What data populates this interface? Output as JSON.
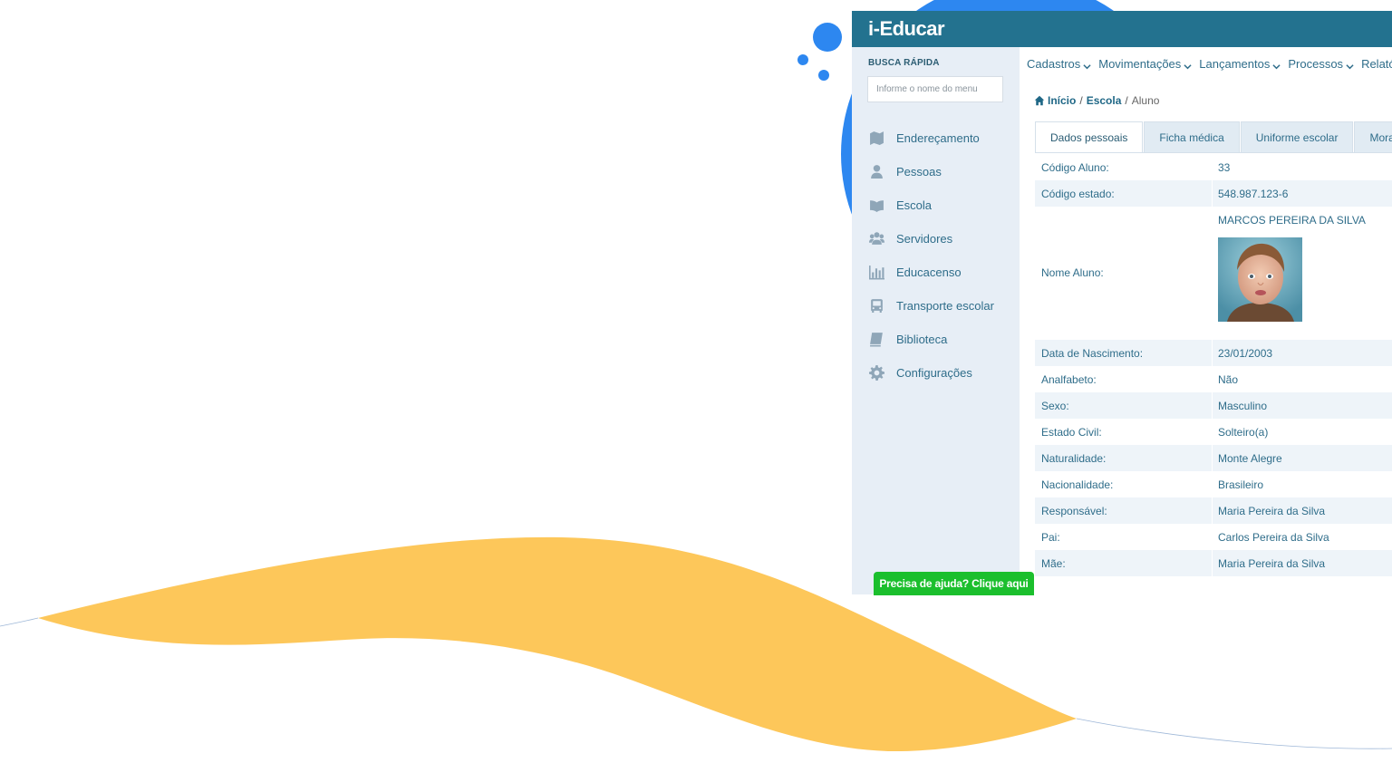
{
  "app": {
    "title": "i-Educar"
  },
  "search": {
    "label": "BUSCA RÁPIDA",
    "placeholder": "Informe o nome do menu"
  },
  "sidebar": {
    "items": [
      {
        "label": "Endereçamento",
        "icon": "map-icon"
      },
      {
        "label": "Pessoas",
        "icon": "user-icon"
      },
      {
        "label": "Escola",
        "icon": "book-open-icon"
      },
      {
        "label": "Servidores",
        "icon": "users-icon"
      },
      {
        "label": "Educacenso",
        "icon": "bar-chart-icon"
      },
      {
        "label": "Transporte escolar",
        "icon": "bus-icon"
      },
      {
        "label": "Biblioteca",
        "icon": "book-icon"
      },
      {
        "label": "Configurações",
        "icon": "gear-icon"
      }
    ]
  },
  "topmenu": {
    "items": [
      {
        "label": "Cadastros"
      },
      {
        "label": "Movimentações"
      },
      {
        "label": "Lançamentos"
      },
      {
        "label": "Processos"
      },
      {
        "label": "Relató"
      }
    ]
  },
  "breadcrumb": {
    "home": "Início",
    "section": "Escola",
    "current": "Aluno",
    "separator": "/"
  },
  "tabs": [
    {
      "label": "Dados pessoais",
      "active": true
    },
    {
      "label": "Ficha médica",
      "active": false
    },
    {
      "label": "Uniforme escolar",
      "active": false
    },
    {
      "label": "Moradia",
      "active": false
    }
  ],
  "student": {
    "rows": [
      {
        "label": "Código Aluno:",
        "value": "33"
      },
      {
        "label": "Código estado:",
        "value": "548.987.123-6"
      },
      {
        "label": "Nome Aluno:",
        "value": "MARCOS PEREIRA DA SILVA"
      },
      {
        "label": "Data de Nascimento:",
        "value": "23/01/2003"
      },
      {
        "label": "Analfabeto:",
        "value": "Não"
      },
      {
        "label": "Sexo:",
        "value": "Masculino"
      },
      {
        "label": "Estado Civil:",
        "value": "Solteiro(a)"
      },
      {
        "label": "Naturalidade:",
        "value": "Monte Alegre"
      },
      {
        "label": "Nacionalidade:",
        "value": "Brasileiro"
      },
      {
        "label": "Responsável:",
        "value": "Maria Pereira da Silva"
      },
      {
        "label": "Pai:",
        "value": "Carlos Pereira da Silva"
      },
      {
        "label": "Mãe:",
        "value": "Maria Pereira da Silva"
      }
    ]
  },
  "help": {
    "label": "Precisa de ajuda? Clique aqui"
  },
  "colors": {
    "header": "#23728f",
    "sidebar_bg": "#e7eef6",
    "link": "#2f6d8a",
    "help_button": "#1bbf2d",
    "wave": "#fdc75a",
    "dots": "#2d87f0"
  }
}
